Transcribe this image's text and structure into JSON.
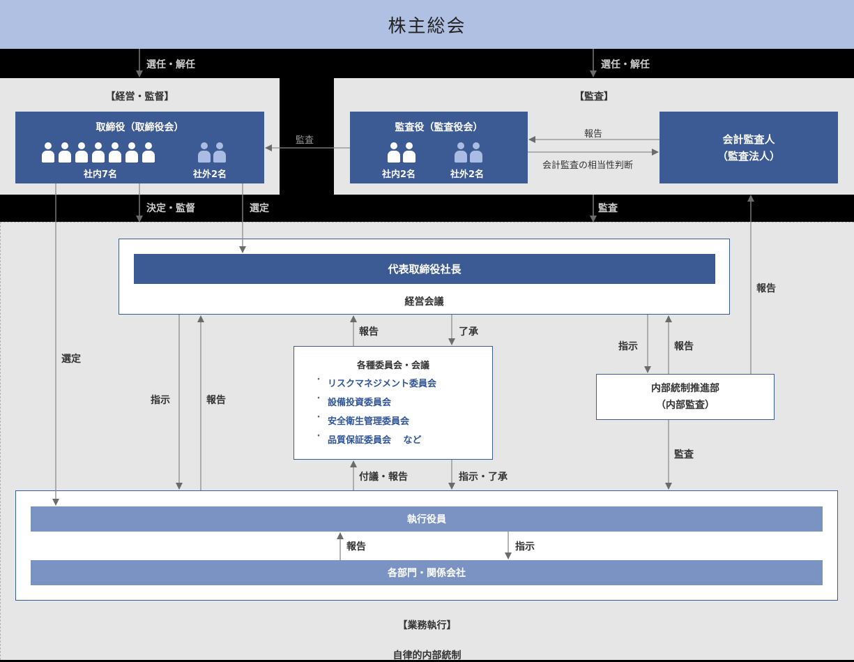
{
  "shareholders": {
    "title": "株主総会"
  },
  "top_links": {
    "left": "選任・解任",
    "right": "選任・解任"
  },
  "management": {
    "section_title": "【経営・監督】",
    "board": {
      "title": "取締役（取締役会）",
      "internal_label": "社内7名",
      "external_label": "社外2名",
      "internal_count": 7,
      "external_count": 2
    }
  },
  "audit": {
    "section_title": "【監査】",
    "auditors": {
      "title": "監査役（監査役会）",
      "internal_label": "社内2名",
      "external_label": "社外2名",
      "internal_count": 2,
      "external_count": 2
    },
    "accounting_auditor": {
      "line1": "会計監査人",
      "line2": "（監査法人）"
    },
    "report_label": "報告",
    "judgement_label": "会計監査の相当性判断",
    "audit_to_board_label": "監査"
  },
  "mid_links": {
    "decision": "決定・監督",
    "select": "選定",
    "audit": "監査"
  },
  "president_block": {
    "title": "代表取締役社長",
    "meeting": "経営会議"
  },
  "links": {
    "select_left": "選定",
    "instruct_left": "指示",
    "report_left": "報告",
    "report_committee_up": "報告",
    "approve_committee": "了承",
    "instruct_internal": "指示",
    "report_internal": "報告",
    "report_accounting": "報告",
    "proposal_report": "付議・報告",
    "instruct_approve": "指示・了承",
    "audit_internal": "監査",
    "report_exec": "報告",
    "instruct_exec": "指示"
  },
  "committees": {
    "title": "各種委員会・会議",
    "items": [
      "リスクマネジメント委員会",
      "設備投資委員会",
      "安全衛生管理委員会",
      "品質保証委員会　 など"
    ]
  },
  "internal_control": {
    "line1": "内部統制推進部",
    "line2": "（内部監査）"
  },
  "executive": {
    "officers": "執行役員",
    "departments": "各部門・関係会社"
  },
  "business": {
    "section_title": "【業務執行】",
    "subtitle": "自律的内部統制"
  },
  "colors": {
    "top_band": "#afc0e2",
    "dark_box": "#3c5a93",
    "mid_box": "#7b93c2",
    "panel": "#e6e6e6",
    "link_text": "#2f5597"
  }
}
